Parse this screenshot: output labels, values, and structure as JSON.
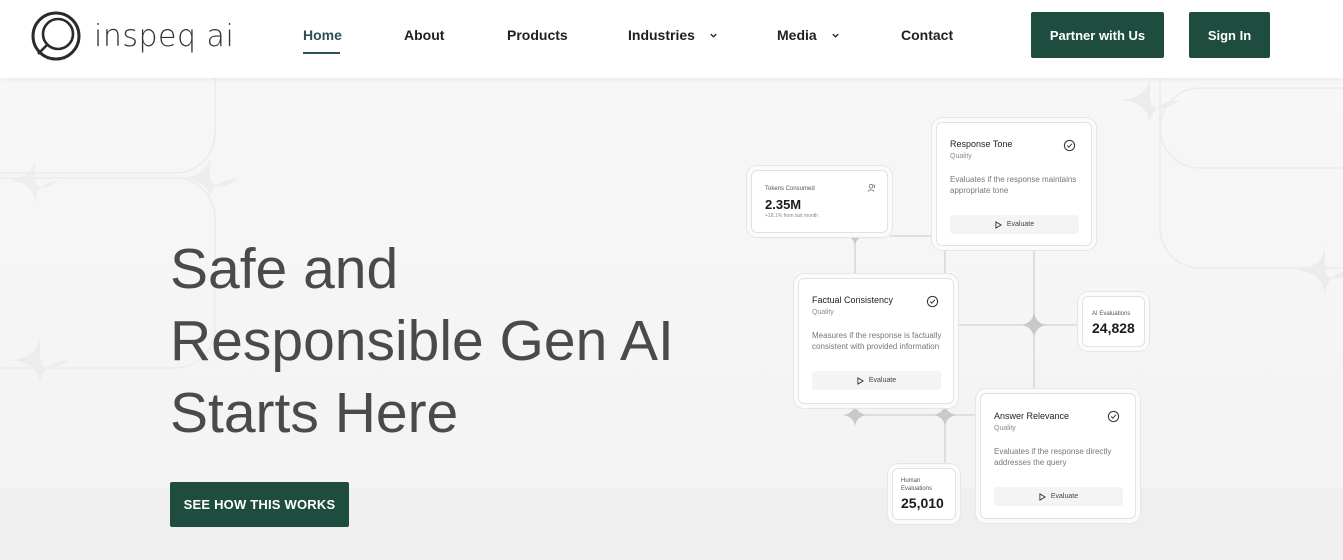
{
  "brand": {
    "name": "inspeq ai"
  },
  "nav": {
    "items": [
      {
        "label": "Home",
        "active": true
      },
      {
        "label": "About"
      },
      {
        "label": "Products"
      },
      {
        "label": "Industries",
        "has_dropdown": true
      },
      {
        "label": "Media",
        "has_dropdown": true
      },
      {
        "label": "Contact"
      }
    ],
    "partner_label": "Partner with Us",
    "signin_label": "Sign In"
  },
  "hero": {
    "lines": [
      "Safe and",
      "Responsible Gen AI",
      "Starts Here"
    ],
    "cta_label": "SEE HOW THIS WORKS"
  },
  "cards": {
    "tokens": {
      "label": "Tokens Consumed",
      "value": "2.35M",
      "note": "+18.1% from last month",
      "icon": "users-icon"
    },
    "response_tone": {
      "title": "Response Tone",
      "category": "Quality",
      "description": "Evaluates if the response maintains appropriate tone",
      "button": "Evaluate"
    },
    "factual": {
      "title": "Factual Consistency",
      "category": "Quality",
      "description": "Measures if the response is factually consistent with provided information",
      "button": "Evaluate"
    },
    "ai_evals": {
      "label": "AI Evaluations",
      "value": "24,828"
    },
    "answer": {
      "title": "Answer Relevance",
      "category": "Quality",
      "description": "Evaluates if the response directly addresses the query",
      "button": "Evaluate"
    },
    "human_evals": {
      "label": "Human Evaluations",
      "value": "25,010"
    }
  },
  "colors": {
    "brand_green": "#1e4d3f",
    "nav_active": "#2f4f5a",
    "hero_text": "#4a4a4a"
  }
}
